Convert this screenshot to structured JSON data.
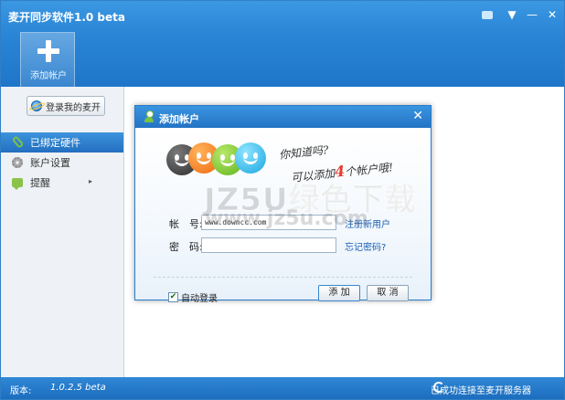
{
  "window": {
    "title": "麦开同步软件1.0 beta"
  },
  "window_controls": {
    "menu": "▼",
    "minimize": "—",
    "close": "✕"
  },
  "header": {
    "add_tile_label": "添加帐户"
  },
  "sidebar": {
    "login_button": "登录我的麦开",
    "items": [
      {
        "label": "已绑定硬件",
        "icon": "link-icon",
        "active": true
      },
      {
        "label": "账户设置",
        "icon": "gear-icon",
        "active": false
      },
      {
        "label": "提醒",
        "icon": "chat-icon",
        "active": false,
        "has_submenu": true
      }
    ],
    "submenu_arrow": "▸"
  },
  "dialog": {
    "title": "添加帐户",
    "close": "✕",
    "slogan_line1": "你知道吗?",
    "slogan_line2_pre": "可以添加",
    "slogan_line2_num": "4",
    "slogan_line2_post": "个帐户哦!",
    "account_label": "帐　号:",
    "account_value": "www.downcc.com",
    "password_label": "密　码:",
    "password_value": "",
    "register_link": "注册新用户",
    "forgot_link": "忘记密码?",
    "auto_login_label": "自动登录",
    "auto_login_checked": true,
    "check_mark": "✔",
    "add_button": "添 加",
    "cancel_button": "取 消"
  },
  "statusbar": {
    "version_label": "版本:",
    "version_value": "1.0.2.5 beta",
    "status_text": "已成功连接至麦开服务器"
  },
  "watermark": {
    "line1": "JZ5U绿色下载",
    "line2": "www.jz5u.com"
  }
}
